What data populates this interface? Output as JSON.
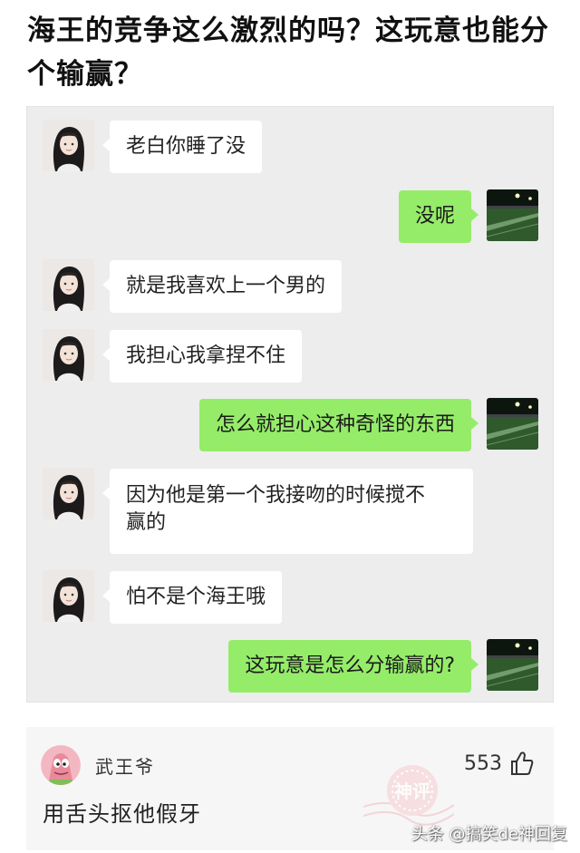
{
  "headline": "海王的竞争这么激烈的吗？这玩意也能分个输赢？",
  "chat": {
    "messages": [
      {
        "side": "left",
        "text": "老白你睡了没"
      },
      {
        "side": "right",
        "text": "没呢"
      },
      {
        "side": "left",
        "text": "就是我喜欢上一个男的"
      },
      {
        "side": "left",
        "text": "我担心我拿捏不住"
      },
      {
        "side": "right",
        "text": "怎么就担心这种奇怪的东西"
      },
      {
        "side": "left",
        "line1": "因为他是第一个我接吻的时候搅不",
        "line2": "赢的"
      },
      {
        "side": "left",
        "text": "怕不是个海王哦"
      },
      {
        "side": "right",
        "text": "这玩意是怎么分输赢的?"
      }
    ]
  },
  "comment": {
    "username": "武王爷",
    "likes": "553",
    "text": "用舌头抠他假牙",
    "badge": "神评"
  },
  "watermark": "头条 @搞笑de神回复",
  "colors": {
    "chat_background": "#ededed",
    "sent_bubble": "#95ec69",
    "received_bubble": "#ffffff"
  },
  "icons": [
    "girl-avatar",
    "football-field-avatar",
    "patrick-star-avatar",
    "thumbs-up-icon",
    "shenping-stamp"
  ]
}
